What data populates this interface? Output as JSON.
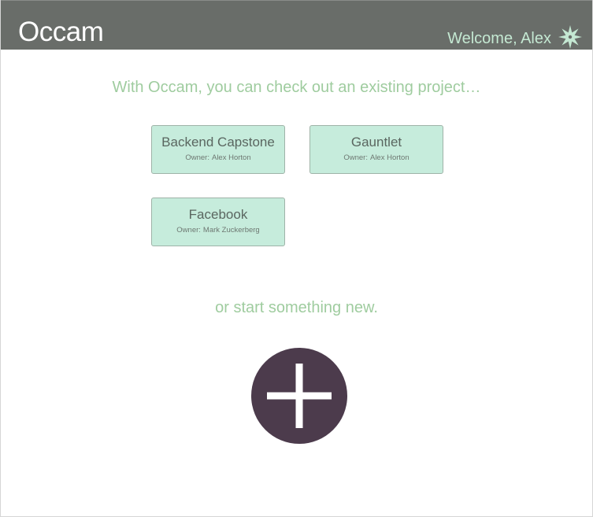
{
  "header": {
    "app_name": "Occam",
    "welcome_text": "Welcome, Alex",
    "settings_icon": "gear-star-icon"
  },
  "main": {
    "intro_text": "With Occam, you can check out an existing project…",
    "owner_prefix": "Owner:",
    "projects": [
      {
        "title": "Backend Capstone",
        "owner": "Alex Horton"
      },
      {
        "title": "Gauntlet",
        "owner": "Alex Horton"
      },
      {
        "title": "Facebook",
        "owner": "Mark Zuckerberg"
      }
    ],
    "new_text": "or start something new.",
    "add_icon": "plus-icon"
  },
  "colors": {
    "header_bg": "#696d69",
    "accent_text": "#9fcc9f",
    "card_bg": "#c6ecdc",
    "add_button_bg": "#4c3b4c"
  }
}
